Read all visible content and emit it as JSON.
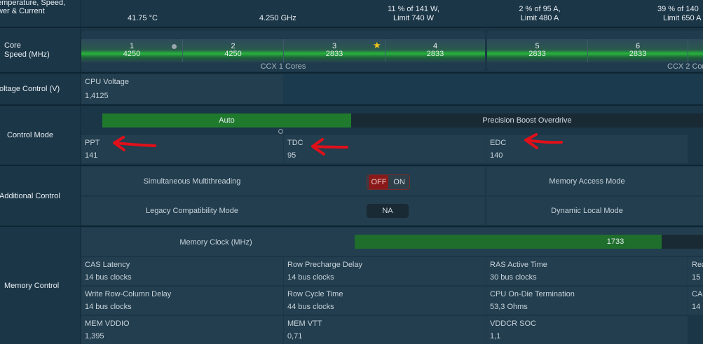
{
  "status": {
    "label": "emperature, Speed,\nwer & Current",
    "temperature": "41.75 °C",
    "speed": "4.250  GHz",
    "ppt_usage": "11 % of 141 W,",
    "ppt_limit": "Limit 740 W",
    "tdc_usage": "2 % of 95 A,",
    "tdc_limit": "Limit 480 A",
    "edc_usage": "39 % of 140",
    "edc_limit": "Limit 650 A"
  },
  "core_speed": {
    "label_line1": "Core",
    "label_line2": "Speed (MHz)",
    "cores": [
      {
        "num": "1",
        "speed": "4250"
      },
      {
        "num": "2",
        "speed": "4250"
      },
      {
        "num": "3",
        "speed": "2833"
      },
      {
        "num": "4",
        "speed": "2833"
      },
      {
        "num": "5",
        "speed": "2833"
      },
      {
        "num": "6",
        "speed": "2833"
      }
    ],
    "ccx1_label": "CCX 1 Cores",
    "ccx2_label": "CCX 2 Cor"
  },
  "voltage": {
    "label": "oltage Control (V)",
    "title": "CPU Voltage",
    "value": "1,4125"
  },
  "control_mode": {
    "label": "Control Mode",
    "option_auto": "Auto",
    "option_pbo": "Precision Boost Overdrive",
    "ppt_title": "PPT",
    "ppt_value": "141",
    "tdc_title": "TDC",
    "tdc_value": "95",
    "edc_title": "EDC",
    "edc_value": "140"
  },
  "additional": {
    "label": "Additional Control",
    "smt_label": "Simultaneous Multithreading",
    "smt_off": "OFF",
    "smt_on": "ON",
    "mem_access_label": "Memory Access Mode",
    "legacy_label": "Legacy Compatibility Mode",
    "legacy_value": "NA",
    "dlm_label": "Dynamic Local Mode"
  },
  "memory": {
    "label": "Memory Control",
    "clock_label": "Memory Clock (MHz)",
    "clock_value": "1733",
    "cells": [
      {
        "title": "CAS Latency",
        "value": "14 bus clocks"
      },
      {
        "title": "Row Precharge Delay",
        "value": "14 bus clocks"
      },
      {
        "title": "RAS Active Time",
        "value": "30 bus clocks"
      },
      {
        "title": "Rea",
        "value": "15"
      },
      {
        "title": "Write Row-Column Delay",
        "value": "14 bus clocks"
      },
      {
        "title": "Row Cycle Time",
        "value": "44 bus clocks"
      },
      {
        "title": "CPU On-Die Termination",
        "value": "53,3 Ohms"
      },
      {
        "title": "CAS",
        "value": "14"
      },
      {
        "title": "MEM VDDIO",
        "value": "1,395"
      },
      {
        "title": "MEM VTT",
        "value": "0,71"
      },
      {
        "title": "VDDCR SOC",
        "value": "1,1"
      }
    ]
  },
  "colors": {
    "background": "#16303f",
    "accent_green": "#1f7a2e",
    "arrow_red": "#e0101a",
    "toggle_red": "#8a1a1a"
  }
}
